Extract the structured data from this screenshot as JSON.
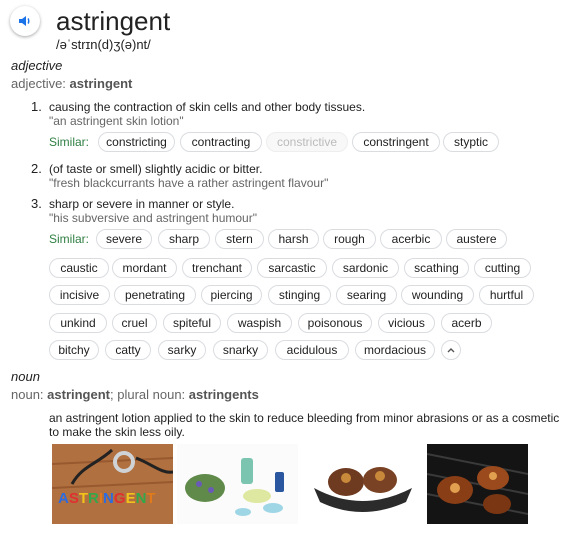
{
  "entry": {
    "word": "astringent",
    "phonetic": "/əˈstrɪn(d)ʒ(ə)nt/",
    "speaker_icon": "speaker-icon"
  },
  "adjective": {
    "pos": "adjective",
    "pos_prefix": "adjective: ",
    "pos_word": "astringent",
    "senses": [
      {
        "num": "1.",
        "definition": "causing the contraction of skin cells and other body tissues.",
        "example": "\"an astringent skin lotion\""
      },
      {
        "num": "2.",
        "definition": "(of taste or smell) slightly acidic or bitter.",
        "example": "\"fresh blackcurrants have a rather astringent flavour\""
      },
      {
        "num": "3.",
        "definition": "sharp or severe in manner or style.",
        "example": "\"his subversive and astringent humour\""
      }
    ],
    "similar_label": "Similar:",
    "similar_1": [
      "constricting",
      "contracting",
      "constrictive",
      "constringent",
      "styptic"
    ],
    "similar_3": [
      "severe",
      "sharp",
      "stern",
      "harsh",
      "rough",
      "acerbic",
      "austere",
      "caustic",
      "mordant",
      "trenchant",
      "sarcastic",
      "sardonic",
      "scathing",
      "cutting",
      "incisive",
      "penetrating",
      "piercing",
      "stinging",
      "searing",
      "wounding",
      "hurtful",
      "unkind",
      "cruel",
      "spiteful",
      "waspish",
      "poisonous",
      "vicious",
      "acerb",
      "bitchy",
      "catty",
      "sarky",
      "snarky",
      "acidulous",
      "mordacious"
    ],
    "collapse_icon": "chevron-up-icon"
  },
  "noun": {
    "pos": "noun",
    "prefix": "noun: ",
    "word": "astringent",
    "sep": "; plural noun: ",
    "plural": "astringents",
    "definition": "an astringent lotion applied to the skin to reduce bleeding from minor abrasions or as a cosmetic to make the skin less oily.",
    "photo_text": "ASTRINGENT"
  },
  "colors": {
    "similar": "#2f7f43",
    "speaker": "#1a73e8",
    "chip_border": "#dadce0"
  }
}
